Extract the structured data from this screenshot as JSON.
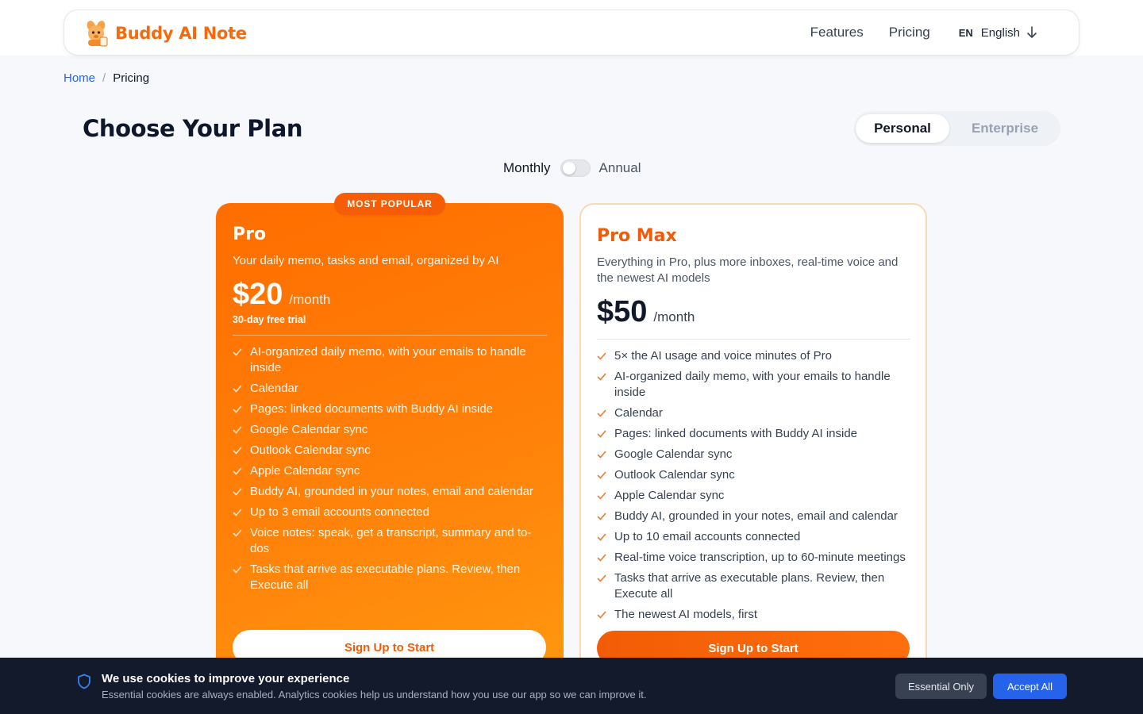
{
  "header": {
    "brand": "Buddy AI Note",
    "nav": [
      "Features",
      "Pricing"
    ],
    "lang_code": "EN",
    "lang_label": "English"
  },
  "breadcrumb": {
    "home": "Home",
    "separator": "/",
    "current": "Pricing"
  },
  "page": {
    "title": "Choose Your Plan"
  },
  "plan_type": {
    "options": [
      "Personal",
      "Enterprise"
    ],
    "selected": "Personal"
  },
  "billing": {
    "monthly_label": "Monthly",
    "annual_label": "Annual",
    "annual_on": false
  },
  "plans": [
    {
      "badge": "MOST POPULAR",
      "name": "Pro",
      "description": "Your daily memo, tasks and email, organized by AI",
      "price": "$20",
      "period": "/month",
      "trial": "30-day free trial",
      "features": [
        "AI-organized daily memo, with your emails to handle inside",
        "Calendar",
        "Pages: linked documents with Buddy AI inside",
        "Google Calendar sync",
        "Outlook Calendar sync",
        "Apple Calendar sync",
        "Buddy AI, grounded in your notes, email and calendar",
        "Up to 3 email accounts connected",
        "Voice notes: speak, get a transcript, summary and to-dos",
        "Tasks that arrive as executable plans. Review, then Execute all"
      ],
      "cta": "Sign Up to Start"
    },
    {
      "name": "Pro Max",
      "description": "Everything in Pro, plus more inboxes, real-time voice and the newest AI models",
      "price": "$50",
      "period": "/month",
      "features": [
        "5× the AI usage and voice minutes of Pro",
        "AI-organized daily memo, with your emails to handle inside",
        "Calendar",
        "Pages: linked documents with Buddy AI inside",
        "Google Calendar sync",
        "Outlook Calendar sync",
        "Apple Calendar sync",
        "Buddy AI, grounded in your notes, email and calendar",
        "Up to 10 email accounts connected",
        "Real-time voice transcription, up to 60-minute meetings",
        "Tasks that arrive as executable plans. Review, then Execute all",
        "The newest AI models, first"
      ],
      "cta": "Sign Up to Start"
    }
  ],
  "cookie": {
    "title": "We use cookies to improve your experience",
    "text": "Essential cookies are always enabled. Analytics cookies help us understand how you use our app so we can improve it.",
    "essential": "Essential Only",
    "accept": "Accept All"
  },
  "colors": {
    "brand": "#f46a0c",
    "accent": "#2563eb",
    "dark": "#131a2b"
  }
}
